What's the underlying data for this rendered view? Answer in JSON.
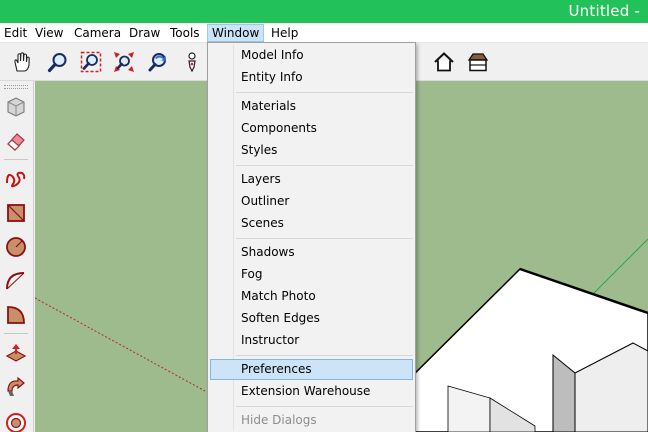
{
  "window": {
    "title": "Untitled -"
  },
  "menubar": {
    "items": [
      "Edit",
      "View",
      "Camera",
      "Draw",
      "Tools",
      "Window",
      "Help"
    ],
    "active": "Window"
  },
  "toolbar": {
    "tools": [
      "pan-icon",
      "zoom-icon",
      "zoom-window-icon",
      "zoom-extents-icon",
      "previous-view-icon",
      "position-camera-icon",
      "home-icon",
      "warehouse-icon"
    ]
  },
  "left_toolbar": {
    "tools": [
      "select-icon",
      "eraser-icon",
      "freehand-icon",
      "rectangle-icon",
      "polygon-icon",
      "arc-icon",
      "pie-icon",
      "push-pull-icon",
      "follow-me-icon",
      "offset-icon"
    ]
  },
  "window_menu": {
    "groups": [
      [
        "Model Info",
        "Entity Info"
      ],
      [
        "Materials",
        "Components",
        "Styles"
      ],
      [
        "Layers",
        "Outliner",
        "Scenes"
      ],
      [
        "Shadows",
        "Fog",
        "Match Photo",
        "Soften Edges",
        "Instructor"
      ],
      [
        "Preferences",
        "Extension Warehouse"
      ],
      [
        "Hide Dialogs"
      ]
    ],
    "highlighted": "Preferences",
    "disabled": [
      "Hide Dialogs"
    ]
  },
  "colors": {
    "title_bar": "#22c15a",
    "viewport_background": "#9ebb8d",
    "menu_highlight": "#cde3f7",
    "model_face": "#ffffff"
  }
}
